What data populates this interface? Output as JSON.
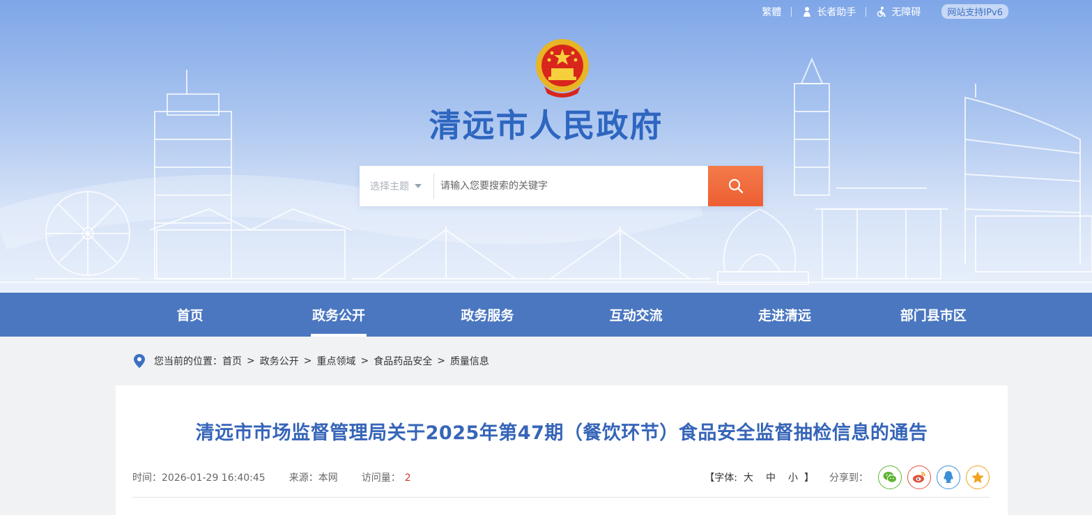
{
  "top_links": {
    "traditional": "繁體",
    "elder": "长者助手",
    "accessibility": "无障碍",
    "ipv6": "网站支持IPv6"
  },
  "site_title": "清远市人民政府",
  "search": {
    "topic_placeholder": "选择主题",
    "input_placeholder": "请输入您要搜索的关键字"
  },
  "nav": {
    "items": [
      {
        "label": "首页"
      },
      {
        "label": "政务公开"
      },
      {
        "label": "政务服务"
      },
      {
        "label": "互动交流"
      },
      {
        "label": "走进清远"
      },
      {
        "label": "部门县市区"
      }
    ],
    "active_index": 1
  },
  "breadcrumb": {
    "prefix": "您当前的位置：",
    "items": [
      "首页",
      "政务公开",
      "重点领域",
      "食品药品安全",
      "质量信息"
    ],
    "separator": ">"
  },
  "article": {
    "title": "清远市市场监督管理局关于2025年第47期（餐饮环节）食品安全监督抽检信息的通告",
    "time_label": "时间：",
    "time": "2026-01-29 16:40:45",
    "source_label": "来源：",
    "source": "本网",
    "hits_label": "访问量：",
    "hits": "2"
  },
  "tools": {
    "font_open": "【字体:",
    "font_large": "大",
    "font_medium": "中",
    "font_small": "小",
    "font_close": "】",
    "share_label": "分享到："
  },
  "colors": {
    "nav_bg": "#4a77c0",
    "title": "#3665b8",
    "search_button": "#ec5f32",
    "hits": "#c8372d",
    "wechat": "#5cb531",
    "weibo": "#e2533d",
    "qq": "#3a8fd6",
    "favorite": "#f0a31d"
  },
  "icons": {
    "share": [
      "wechat-icon",
      "weibo-icon",
      "qq-icon",
      "favorite-icon"
    ]
  }
}
